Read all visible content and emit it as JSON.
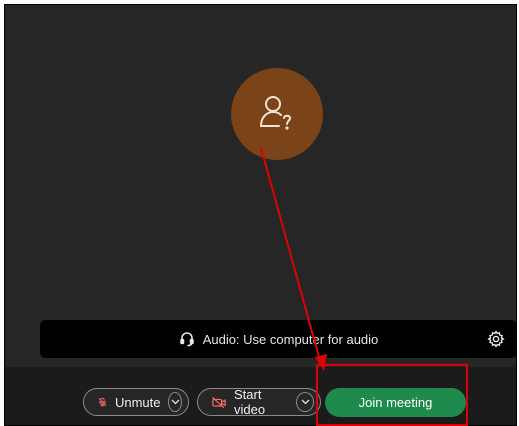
{
  "avatar": {
    "icon": "unknown-user-icon",
    "color": "#7a4418"
  },
  "audio_bar": {
    "label": "Audio: Use computer for audio",
    "icon": "headset-icon",
    "settings_icon": "gear-icon"
  },
  "toolbar": {
    "unmute_label": "Unmute",
    "start_video_label": "Start video",
    "join_label": "Join meeting",
    "join_color": "#1e8a4c"
  },
  "annotation": {
    "color": "#e00000"
  }
}
